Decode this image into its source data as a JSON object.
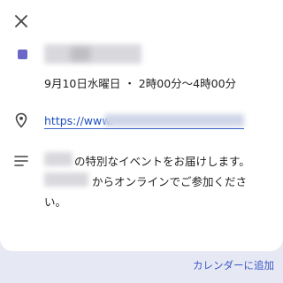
{
  "colors": {
    "event_color": "#6a67c8"
  },
  "event": {
    "datetime": "9月10日水曜日 ・ 2時00分～4時00分",
    "location_text": "https://www.",
    "description_line1": "の特別なイベントをお届けします。",
    "description_line2": "からオンラインでご参加くださ",
    "description_line3": "い。"
  },
  "actions": {
    "add_to_calendar": "カレンダーに追加"
  },
  "icons": {
    "close": "close-icon",
    "location": "location-pin-icon",
    "description": "notes-icon"
  }
}
